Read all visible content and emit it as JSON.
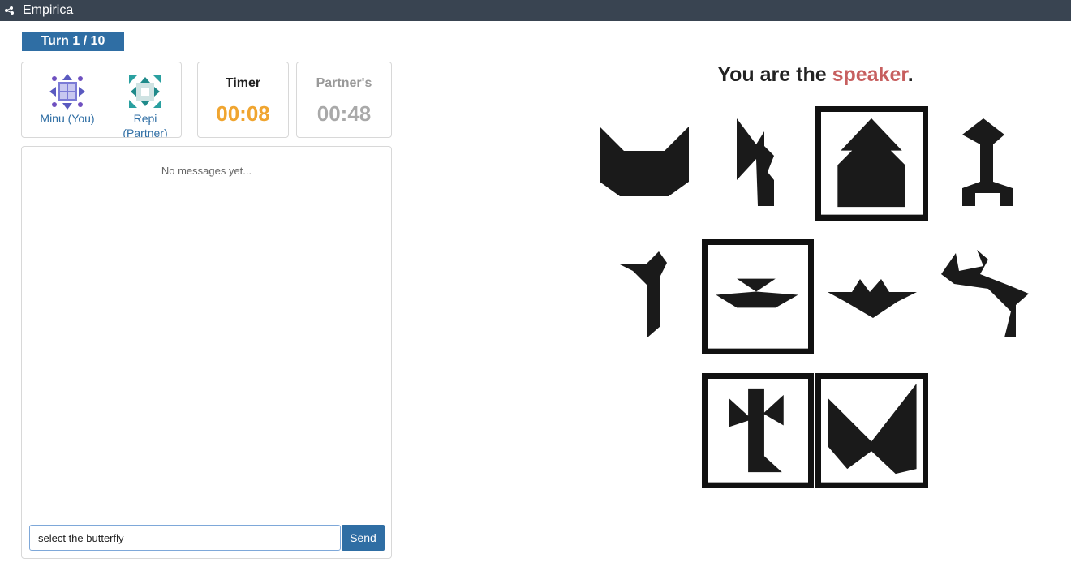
{
  "app": {
    "title": "Empirica"
  },
  "turn": {
    "label": "Turn 1 / 10"
  },
  "players": [
    {
      "label": "Minu (You)",
      "avatar": "purple-quilt-avatar"
    },
    {
      "label": "Repi (Partner)",
      "avatar": "teal-quilt-avatar"
    }
  ],
  "timer": {
    "label": "Timer",
    "value": "00:08"
  },
  "partner_timer": {
    "label": "Partner's",
    "value": "00:48"
  },
  "chat": {
    "empty_text": "No messages yet...",
    "input_value": "select the butterfly",
    "send_label": "Send"
  },
  "role": {
    "prefix": "You are the ",
    "role": "speaker",
    "suffix": "."
  },
  "tangrams": [
    {
      "shape": "cat-head",
      "selected": false
    },
    {
      "shape": "flag-figure",
      "selected": false
    },
    {
      "shape": "house-arrow",
      "selected": true
    },
    {
      "shape": "standing-figure",
      "selected": false
    },
    {
      "shape": "hook-figure",
      "selected": false
    },
    {
      "shape": "bowtie-bar",
      "selected": true
    },
    {
      "shape": "bird",
      "selected": false
    },
    {
      "shape": "bending-figure",
      "selected": false
    },
    {
      "shape": "tower-figure",
      "selected": true
    },
    {
      "shape": "butterfly",
      "selected": true
    }
  ],
  "colors": {
    "topbar": "#394451",
    "primary": "#2f6ea4",
    "timer": "#f0a530",
    "role_highlight": "#c75f5f"
  }
}
